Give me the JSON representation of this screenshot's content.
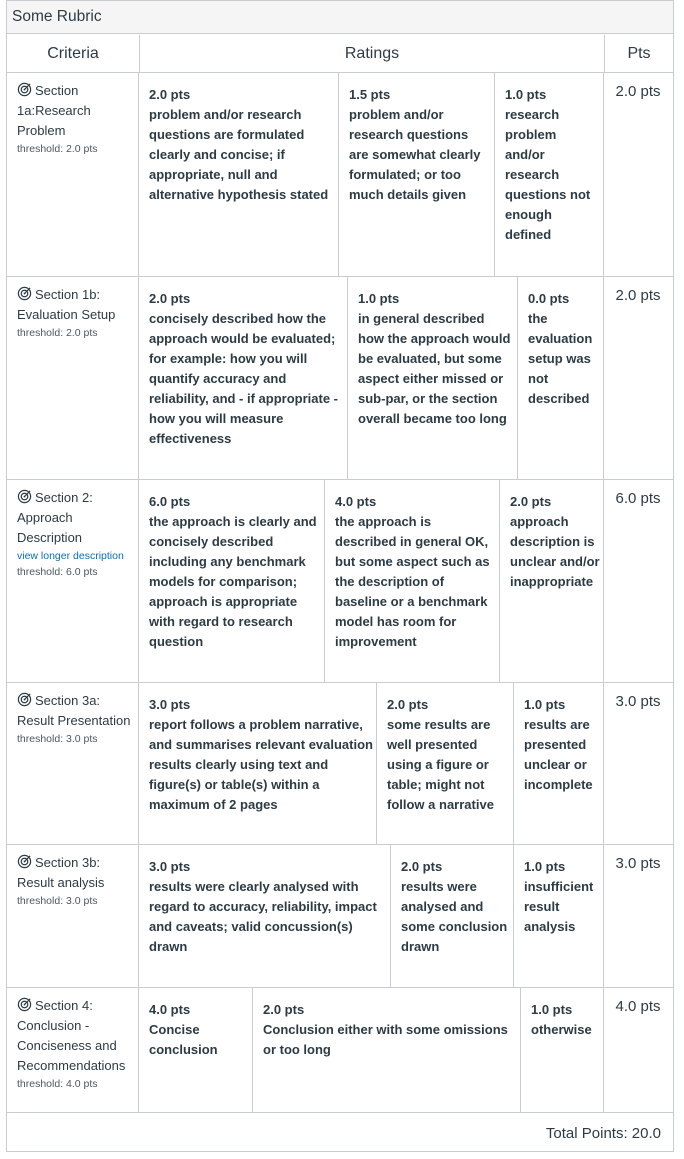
{
  "title": "Some Rubric",
  "headers": {
    "criteria": "Criteria",
    "ratings": "Ratings",
    "pts": "Pts"
  },
  "rows": [
    {
      "name": "Section 1a:Research Problem",
      "threshold": "threshold: 2.0 pts",
      "link": "",
      "points": "2.0 pts",
      "ratings": [
        {
          "pts": "2.0 pts",
          "desc": "problem and/or research questions are formulated clearly and concise; if appropriate, null and alternative hypothesis stated"
        },
        {
          "pts": "1.5 pts",
          "desc": "problem and/or research questions are somewhat clearly formulated; or too much details given"
        },
        {
          "pts": "1.0 pts",
          "desc": "research problem and/or research questions not enough defined"
        }
      ]
    },
    {
      "name": "Section 1b: Evaluation Setup",
      "threshold": "threshold: 2.0 pts",
      "link": "",
      "points": "2.0 pts",
      "ratings": [
        {
          "pts": "2.0 pts",
          "desc": "concisely described how the approach would be evaluated; for example: how you will quantify accuracy and reliability, and - if appropriate - how you will measure effectiveness"
        },
        {
          "pts": "1.0 pts",
          "desc": "in general described how the approach would be evaluated, but some aspect either missed or sub-par, or the section overall became too long"
        },
        {
          "pts": "0.0 pts",
          "desc": "the evaluation setup was not described"
        }
      ]
    },
    {
      "name": "Section 2: Approach Description",
      "threshold": "threshold: 6.0 pts",
      "link": "view longer description",
      "points": "6.0 pts",
      "ratings": [
        {
          "pts": "6.0 pts",
          "desc": "the approach is clearly and concisely described including any benchmark models for comparison; approach is appropriate with regard to research question"
        },
        {
          "pts": "4.0 pts",
          "desc": "the approach is described in general OK, but some aspect such as the description of baseline or a benchmark model has room for improvement"
        },
        {
          "pts": "2.0 pts",
          "desc": "approach description is unclear and/or inappropriate"
        }
      ]
    },
    {
      "name": "Section 3a: Result Presentation",
      "threshold": "threshold: 3.0 pts",
      "link": "",
      "points": "3.0 pts",
      "ratings": [
        {
          "pts": "3.0 pts",
          "desc": "report follows a problem narrative, and summarises relevant evaluation results clearly using text and figure(s) or table(s) within a maximum of 2 pages"
        },
        {
          "pts": "2.0 pts",
          "desc": "some results are well presented using a figure or table; might not follow a narrative"
        },
        {
          "pts": "1.0 pts",
          "desc": "results are presented unclear or incomplete"
        }
      ]
    },
    {
      "name": "Section 3b: Result analysis",
      "threshold": "threshold: 3.0 pts",
      "link": "",
      "points": "3.0 pts",
      "ratings": [
        {
          "pts": "3.0 pts",
          "desc": "results were clearly analysed with regard to accuracy, reliability, impact and caveats; valid concussion(s) drawn"
        },
        {
          "pts": "2.0 pts",
          "desc": "results were analysed and some conclusion drawn"
        },
        {
          "pts": "1.0 pts",
          "desc": "insufficient result analysis"
        }
      ]
    },
    {
      "name": "Section 4: Conclusion - Conciseness and Recommendations",
      "threshold": "threshold: 4.0 pts",
      "link": "",
      "points": "4.0 pts",
      "ratings": [
        {
          "pts": "4.0 pts",
          "desc": "Concise conclusion"
        },
        {
          "pts": "2.0 pts",
          "desc": "Conclusion either with some omissions or too long"
        },
        {
          "pts": "1.0 pts",
          "desc": "otherwise"
        }
      ]
    }
  ],
  "total": "Total Points: 20.0"
}
